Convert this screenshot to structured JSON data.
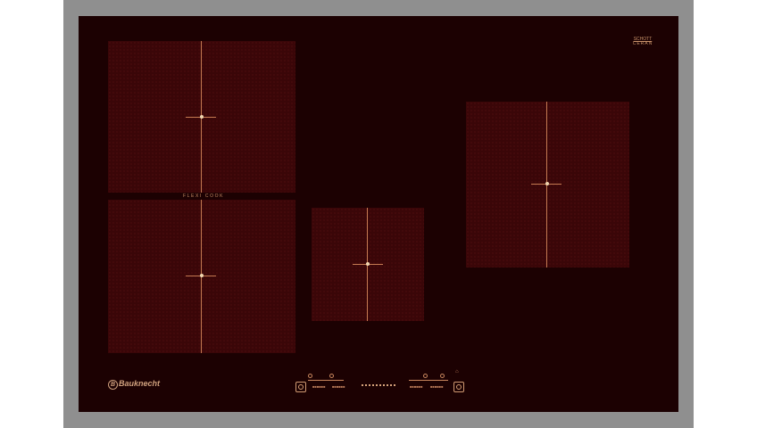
{
  "hob": {
    "brand": "Bauknecht",
    "flexi_label": "FLEXI COOK",
    "glass_brand_top": "SCHOTT",
    "glass_brand_bottom": "CERAN"
  },
  "controls": {
    "left_timer_label": "■■■■■■",
    "right_timer_label": "■■■■■■",
    "lock_symbol": "⌂"
  },
  "colors": {
    "glass": "#1c0102",
    "zone": "#3a0608",
    "markings": "#c57a52",
    "frame": "#8f8f8f"
  }
}
